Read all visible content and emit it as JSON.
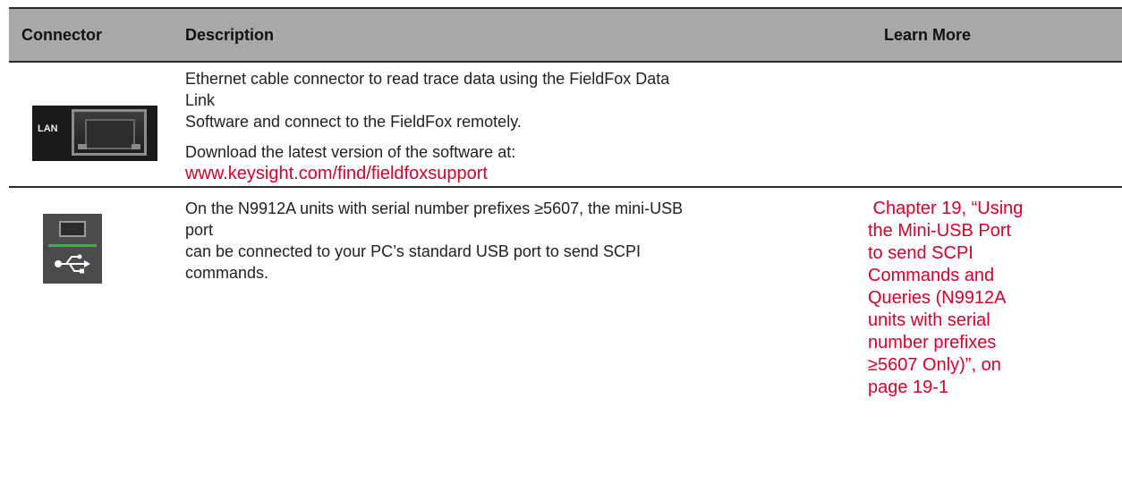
{
  "header": {
    "connector": "Connector",
    "description": "Description",
    "learn_more": "Learn More"
  },
  "rows": [
    {
      "image": {
        "icon": "lan-connector-icon",
        "label": "LAN"
      },
      "description_lines": [
        "Ethernet cable connector to read trace data using the FieldFox Data Link",
        "Software and connect to the FieldFox remotely."
      ],
      "download_text": "Download the latest version of the software at:",
      "link": "www.keysight.com/find/fieldfoxsupport",
      "learn_more": ""
    },
    {
      "image": {
        "icon": "usb-connector-icon"
      },
      "description_lines": [
        "On the N9912A units with serial number prefixes ≥5607, the mini-USB port",
        "can be connected to your PC’s standard USB port to send SCPI commands."
      ],
      "learn_more_lines": [
        " Chapter 19, “Using",
        "the Mini-USB Port",
        "to send SCPI",
        "Commands and",
        "Queries (N9912A",
        "units with serial",
        "number prefixes",
        "≥5607 Only)”, on",
        "page 19-1"
      ]
    }
  ],
  "colors": {
    "header_bg": "#a8a8a8",
    "link": "#d3002c",
    "rule": "#2a2a2a",
    "usb_accent": "#3fae4a"
  }
}
